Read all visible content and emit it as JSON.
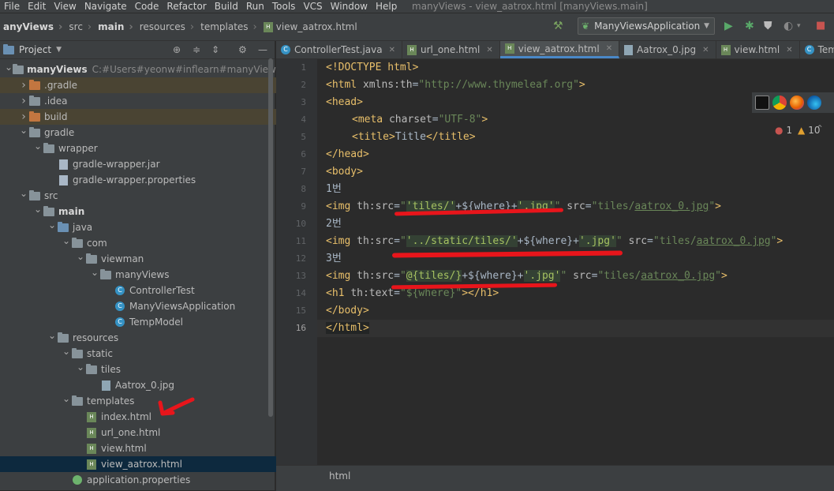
{
  "menubar": [
    "File",
    "Edit",
    "View",
    "Navigate",
    "Code",
    "Refactor",
    "Build",
    "Run",
    "Tools",
    "VCS",
    "Window",
    "Help"
  ],
  "window_title": "manyViews - view_aatrox.html [manyViews.main]",
  "breadcrumb": [
    "anyViews",
    "src",
    "main",
    "resources",
    "templates",
    "view_aatrox.html"
  ],
  "run_config": "ManyViewsApplication",
  "project_panel": {
    "title": "Project",
    "tree": [
      {
        "label": "manyViews",
        "suffix": "C:#Users#yeonw#inflearn#manyViews",
        "depth": 0,
        "icon": "folder",
        "expanded": true,
        "bold": true
      },
      {
        "label": ".gradle",
        "depth": 1,
        "icon": "folder-orange",
        "expanded": false,
        "highlight": "yellow"
      },
      {
        "label": ".idea",
        "depth": 1,
        "icon": "folder",
        "expanded": false
      },
      {
        "label": "build",
        "depth": 1,
        "icon": "folder-orange",
        "expanded": false,
        "highlight": "yellow"
      },
      {
        "label": "gradle",
        "depth": 1,
        "icon": "folder",
        "expanded": true
      },
      {
        "label": "wrapper",
        "depth": 2,
        "icon": "folder",
        "expanded": true
      },
      {
        "label": "gradle-wrapper.jar",
        "depth": 3,
        "icon": "file"
      },
      {
        "label": "gradle-wrapper.properties",
        "depth": 3,
        "icon": "file"
      },
      {
        "label": "src",
        "depth": 1,
        "icon": "folder",
        "expanded": true
      },
      {
        "label": "main",
        "depth": 2,
        "icon": "folder",
        "expanded": true,
        "bold": true
      },
      {
        "label": "java",
        "depth": 3,
        "icon": "folder-blue",
        "expanded": true
      },
      {
        "label": "com",
        "depth": 4,
        "icon": "folder",
        "expanded": true
      },
      {
        "label": "viewman",
        "depth": 5,
        "icon": "folder",
        "expanded": true
      },
      {
        "label": "manyViews",
        "depth": 6,
        "icon": "folder",
        "expanded": true
      },
      {
        "label": "ControllerTest",
        "depth": 7,
        "icon": "class"
      },
      {
        "label": "ManyViewsApplication",
        "depth": 7,
        "icon": "class"
      },
      {
        "label": "TempModel",
        "depth": 7,
        "icon": "class"
      },
      {
        "label": "resources",
        "depth": 3,
        "icon": "folder",
        "expanded": true
      },
      {
        "label": "static",
        "depth": 4,
        "icon": "folder",
        "expanded": true
      },
      {
        "label": "tiles",
        "depth": 5,
        "icon": "folder",
        "expanded": true
      },
      {
        "label": "Aatrox_0.jpg",
        "depth": 6,
        "icon": "image"
      },
      {
        "label": "templates",
        "depth": 4,
        "icon": "folder",
        "expanded": true
      },
      {
        "label": "index.html",
        "depth": 5,
        "icon": "html"
      },
      {
        "label": "url_one.html",
        "depth": 5,
        "icon": "html"
      },
      {
        "label": "view.html",
        "depth": 5,
        "icon": "html"
      },
      {
        "label": "view_aatrox.html",
        "depth": 5,
        "icon": "html",
        "selected": true
      },
      {
        "label": "application.properties",
        "depth": 4,
        "icon": "props"
      }
    ]
  },
  "tabs": [
    {
      "label": "ControllerTest.java",
      "icon": "class"
    },
    {
      "label": "url_one.html",
      "icon": "html"
    },
    {
      "label": "view_aatrox.html",
      "icon": "html",
      "active": true
    },
    {
      "label": "Aatrox_0.jpg",
      "icon": "image"
    },
    {
      "label": "view.html",
      "icon": "html"
    },
    {
      "label": "TempMod",
      "icon": "class"
    }
  ],
  "inspections": {
    "errors": "1",
    "warnings": "10"
  },
  "line_numbers": [
    "1",
    "2",
    "3",
    "4",
    "5",
    "6",
    "7",
    "8",
    "9",
    "10",
    "11",
    "12",
    "13",
    "14",
    "15",
    "16"
  ],
  "code": {
    "l1": "<!DOCTYPE html>",
    "l2a": "<html ",
    "l2b": "xmlns:th",
    "l2c": "=",
    "l2d": "\"http://www.thymeleaf.org\"",
    "l2e": ">",
    "l3": "<head>",
    "l4a": "<meta ",
    "l4b": "charset",
    "l4c": "=",
    "l4d": "\"UTF-8\"",
    "l4e": ">",
    "l5a": "<title>",
    "l5b": "Title",
    "l5c": "</title>",
    "l6": "</head>",
    "l7": "<body>",
    "l8": "1번",
    "l9a": "<img ",
    "l9b": "th:src",
    "l9c": "=",
    "l9d": "\"",
    "l9e": "'tiles/'",
    "l9f": "+${where}+",
    "l9g": "'.jpg'",
    "l9h": "\"",
    "l9i": " src",
    "l9j": "=",
    "l9k": "\"tiles/",
    "l9l": "aatrox_0.jpg",
    "l9m": "\"",
    "l9n": ">",
    "l10": "2번",
    "l11a": "<img ",
    "l11b": "th:src",
    "l11c": "=",
    "l11d": "\"",
    "l11e": "'../static/tiles/'",
    "l11f": "+${where}+",
    "l11g": "'.jpg'",
    "l11h": "\"",
    "l11i": " src",
    "l11j": "=",
    "l11k": "\"tiles/",
    "l11l": "aatrox_0.jpg",
    "l11m": "\"",
    "l11n": ">",
    "l12": "3번",
    "l13a": "<img ",
    "l13b": "th:src",
    "l13c": "=",
    "l13d": "\"",
    "l13e": "@{tiles/}",
    "l13f": "+${where}+",
    "l13g": "'.jpg'",
    "l13h": "\"",
    "l13i": " src",
    "l13j": "=",
    "l13k": "\"tiles/",
    "l13l": "aatrox_0.jpg",
    "l13m": "\"",
    "l13n": ">",
    "l14a": "<h1 ",
    "l14b": "th:text",
    "l14c": "=",
    "l14d": "\"${where}\"",
    "l14e": "></h1>",
    "l15": "</body>",
    "l16": "</html>"
  },
  "status_bar": {
    "context": "html"
  },
  "colors": {
    "accent": "#4a88c7",
    "annotation_red": "#e8151b"
  }
}
